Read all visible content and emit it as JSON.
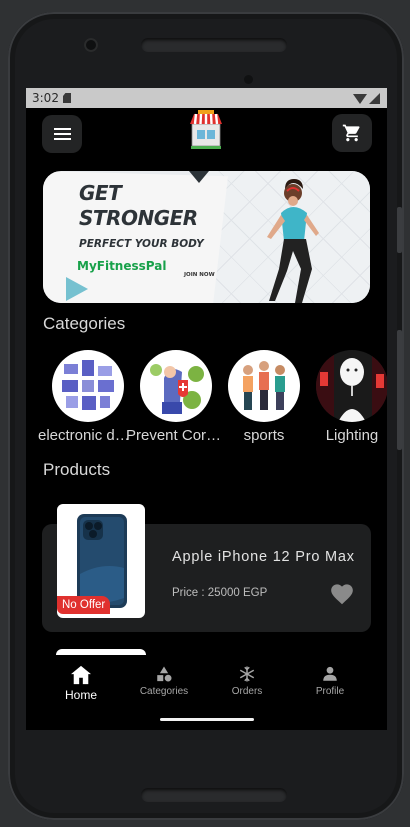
{
  "status_bar": {
    "time": "3:02"
  },
  "banner": {
    "headline_line1": "GET",
    "headline_line2": "STRONGER",
    "subline": "PERFECT YOUR BODY",
    "brand": "MyFitnessPal",
    "cta": "JOIN NOW"
  },
  "categories": {
    "title": "Categories",
    "items": [
      {
        "label": "electronic devices"
      },
      {
        "label": "Prevent Corona"
      },
      {
        "label": "sports"
      },
      {
        "label": "Lighting"
      }
    ]
  },
  "products": {
    "title": "Products",
    "items": [
      {
        "name": "Apple iPhone 12 Pro Max",
        "price": "Price : 25000 EGP",
        "badge": "No Offer",
        "favorite": true
      }
    ]
  },
  "bottom_nav": {
    "items": [
      {
        "label": "Home",
        "icon": "home-icon",
        "active": true
      },
      {
        "label": "Categories",
        "icon": "categories-icon",
        "active": false
      },
      {
        "label": "Orders",
        "icon": "orders-icon",
        "active": false
      },
      {
        "label": "Profile",
        "icon": "profile-icon",
        "active": false
      }
    ]
  },
  "colors": {
    "background": "#000000",
    "card": "#1e1f20",
    "badge": "#e0312e",
    "brand_green": "#18a14a"
  }
}
